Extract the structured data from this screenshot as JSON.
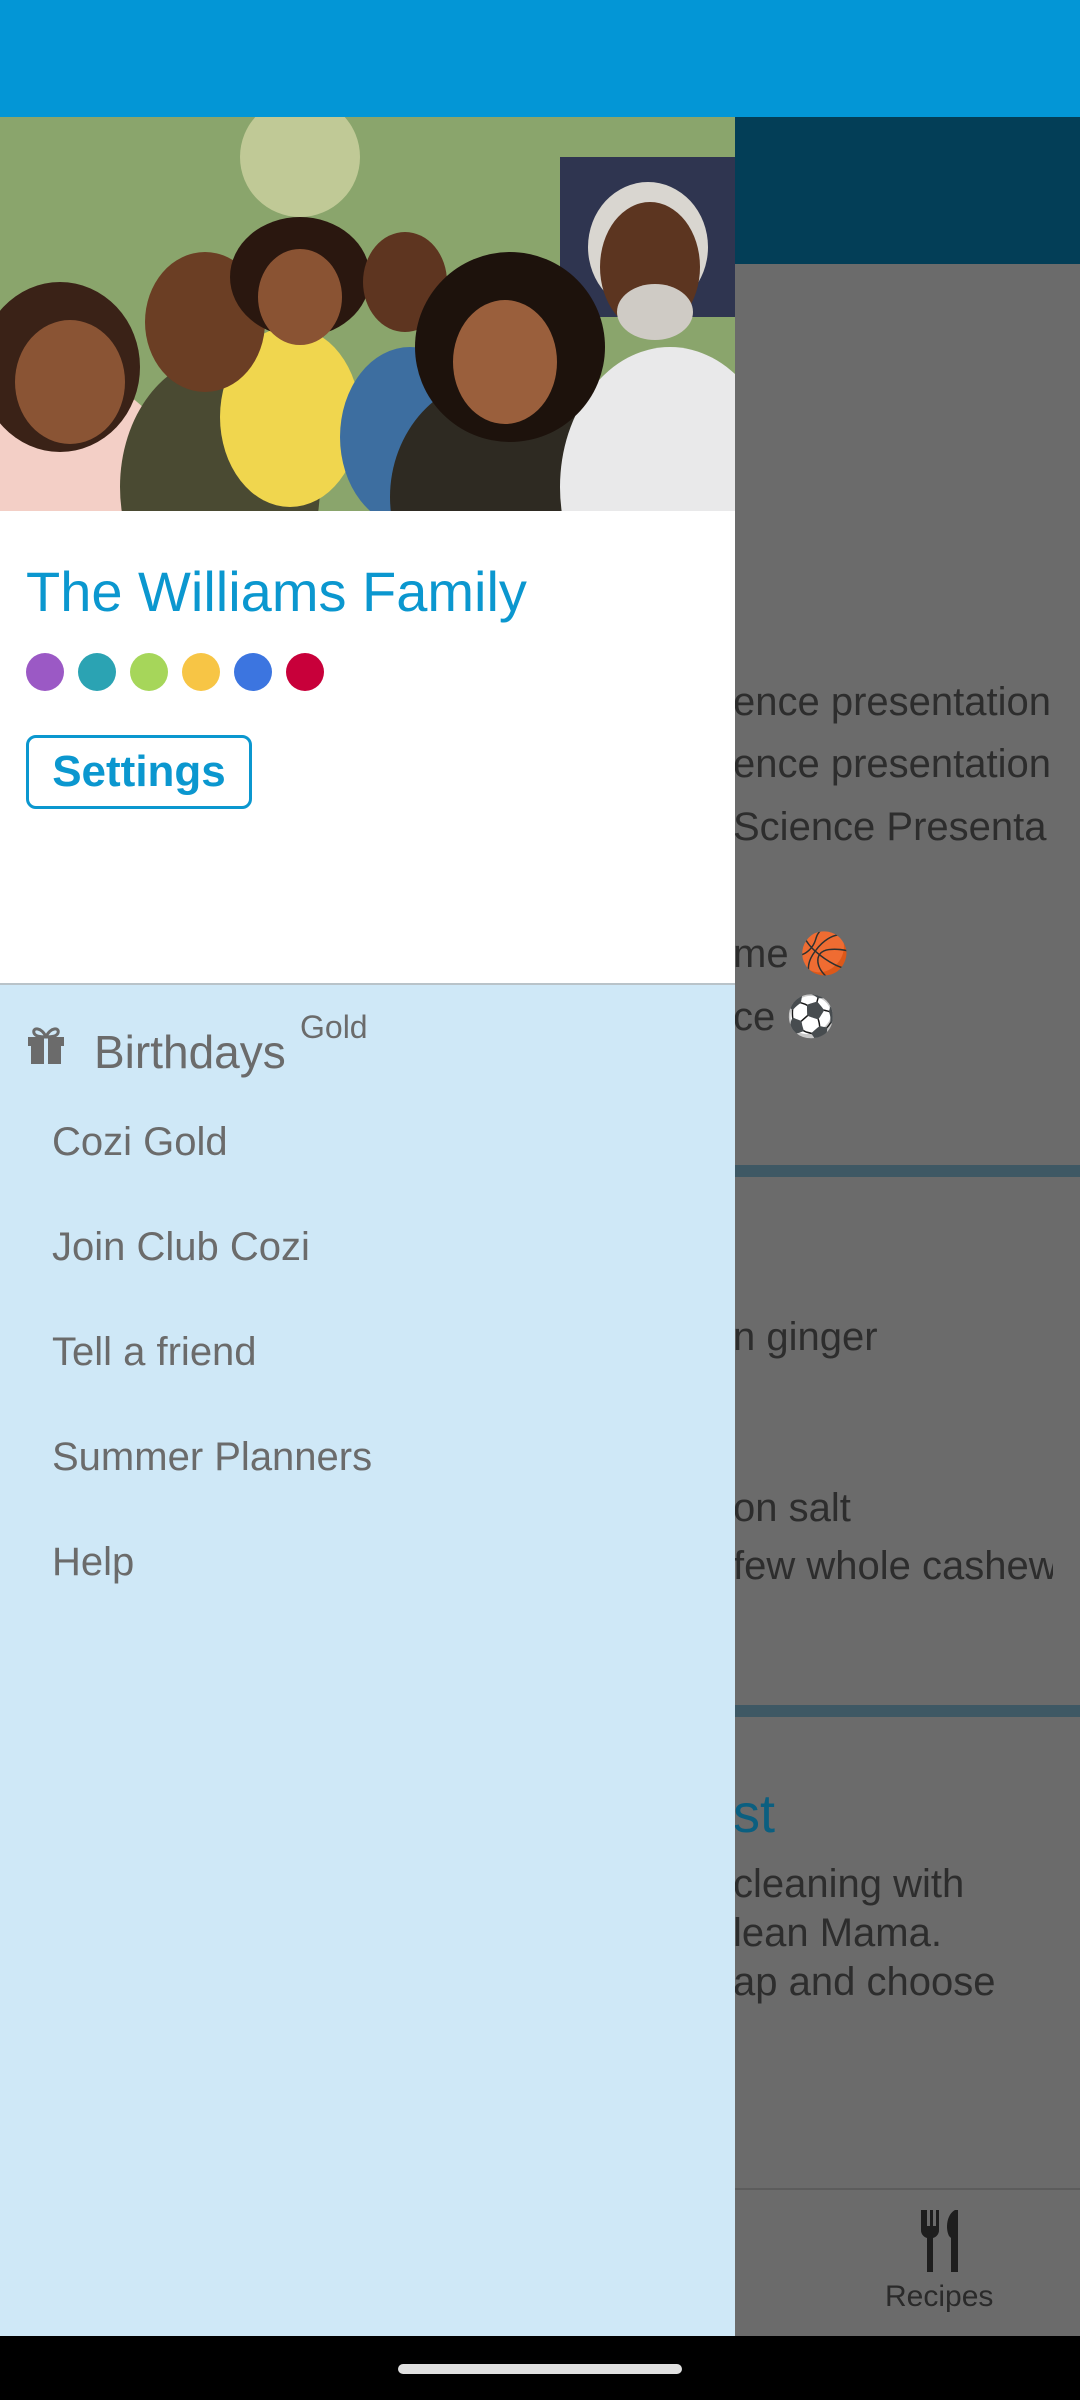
{
  "colors": {
    "accent": "#0b97cf",
    "status_bar": "#0396d6",
    "drawer_bg": "#cfe8f7",
    "member_dots": [
      "#9b59c5",
      "#2ba3b3",
      "#a6d65a",
      "#f7c545",
      "#3c75e0",
      "#c8003a"
    ]
  },
  "drawer": {
    "family_name": "The Williams Family",
    "settings_label": "Settings",
    "birthdays_label": "Birthdays",
    "birthdays_badge": "Gold",
    "items": [
      "Cozi Gold",
      "Join Club Cozi",
      "Tell a friend",
      "Summer Planners",
      "Help"
    ]
  },
  "background": {
    "lines": [
      "ence presentation",
      "ence presentation",
      "Science Presenta",
      "me 🏀",
      "ce ⚽",
      "n ginger",
      "on salt",
      " few whole cashew",
      " cleaning with",
      "lean Mama.",
      "ap and choose"
    ],
    "card_title": "st",
    "nav_recipes": "Recipes"
  }
}
